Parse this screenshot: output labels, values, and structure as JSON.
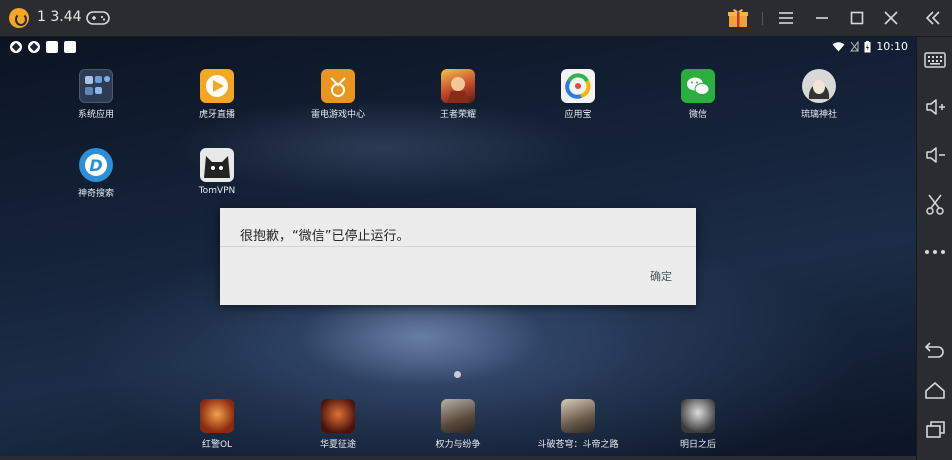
{
  "window": {
    "title": "1 3.44"
  },
  "statusbar": {
    "time": "10:10"
  },
  "apps_top": [
    {
      "label": "系统应用",
      "icon": "folder-icon"
    },
    {
      "label": "虎牙直播",
      "icon": "huya-icon"
    },
    {
      "label": "雷电游戏中心",
      "icon": "game-center-icon"
    },
    {
      "label": "王者荣耀",
      "icon": "honor-of-kings-icon"
    },
    {
      "label": "应用宝",
      "icon": "app-store-icon"
    },
    {
      "label": "微信",
      "icon": "wechat-icon"
    },
    {
      "label": "琉璃神社",
      "icon": "anime-girl-icon"
    },
    {
      "label": "神奇搜索",
      "icon": "search-d-icon"
    },
    {
      "label": "TomVPN",
      "icon": "cat-vpn-icon"
    }
  ],
  "apps_dock": [
    {
      "label": "红警OL",
      "icon": "red-alert-icon"
    },
    {
      "label": "华夏征途",
      "icon": "huaxia-icon"
    },
    {
      "label": "权力与纷争",
      "icon": "power-strife-icon"
    },
    {
      "label": "斗破苍穹：斗帝之路",
      "icon": "doupo-icon"
    },
    {
      "label": "明日之后",
      "icon": "tomorrow-icon"
    }
  ],
  "dialog": {
    "message": "很抱歉，“微信”已停止运行。",
    "ok_label": "确定"
  },
  "colors": {
    "chrome": "#2b2c31",
    "logo": "#f5a623",
    "gift": "#f0a23a",
    "dialog_bg": "#ececec",
    "dialog_button": "#3d5a5a"
  }
}
